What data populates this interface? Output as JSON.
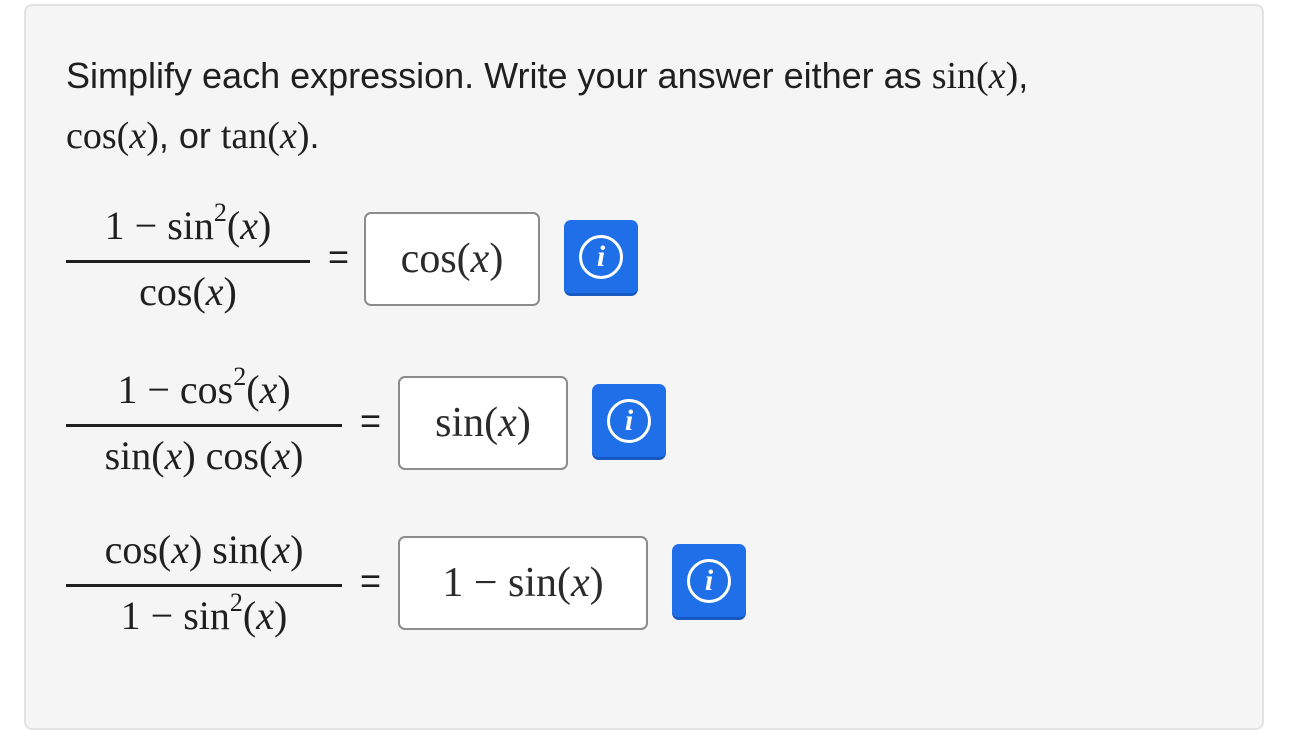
{
  "instructions": {
    "prefix": "Simplify each expression. Write your answer either as",
    "option1": "sin(x)",
    "option2": "cos(x)",
    "joiner": ", or",
    "option3": "tan(x)"
  },
  "problems": [
    {
      "numerator": "1 − sin²(x)",
      "denominator": "cos(x)",
      "equals": "=",
      "answer": "cos(x)",
      "info_icon": "info-icon"
    },
    {
      "numerator": "1 − cos²(x)",
      "denominator": "sin(x) cos(x)",
      "equals": "=",
      "answer": "sin(x)",
      "info_icon": "info-icon"
    },
    {
      "numerator": "cos(x) sin(x)",
      "denominator": "1 − sin²(x)",
      "equals": "=",
      "answer": "1 − sin(x)",
      "info_icon": "info-icon"
    }
  ],
  "colors": {
    "info_button": "#1f6fe8",
    "card_background": "#f5f5f5",
    "input_border": "#8c8c8c"
  }
}
